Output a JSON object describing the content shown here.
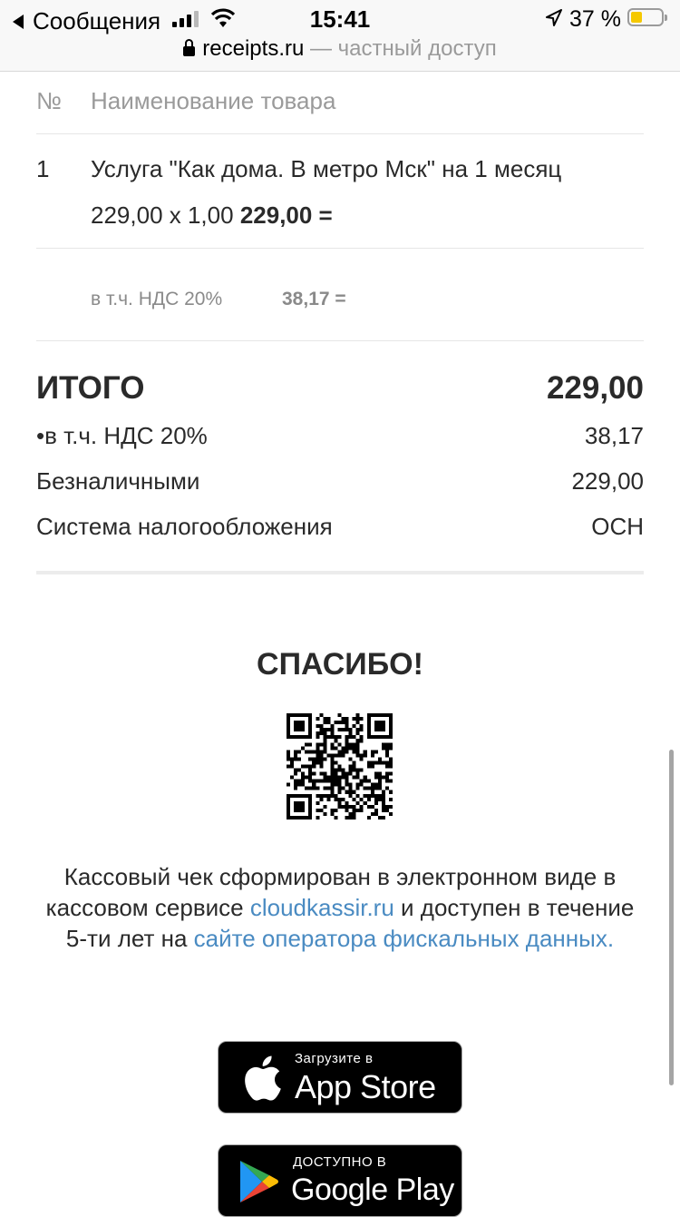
{
  "status_bar": {
    "back_label": "Сообщения",
    "time": "15:41",
    "battery_percent": "37 %",
    "battery_level": 0.37
  },
  "url_bar": {
    "domain": "receipts.ru",
    "suffix": "— частный доступ"
  },
  "table": {
    "header_num": "№",
    "header_name": "Наименование товара",
    "item": {
      "num": "1",
      "name": "Услуга \"Как дома. В метро Мск\" на 1 месяц",
      "calc": "229,00 x 1,00",
      "sum": "229,00 ="
    },
    "vat_label": "в т.ч. НДС 20%",
    "vat_value": "38,17 ="
  },
  "totals": {
    "total_label": "ИТОГО",
    "total_value": "229,00",
    "rows": [
      {
        "label": "•в т.ч. НДС 20%",
        "value": "38,17"
      },
      {
        "label": "Безналичными",
        "value": "229,00"
      },
      {
        "label": "Система налогообложения",
        "value": "ОСН"
      }
    ]
  },
  "footer": {
    "thanks": "СПАСИБО!",
    "note_part1": "Кассовый чек сформирован в электронном виде в кассовом сервисе ",
    "note_link1": "cloudkassir.ru",
    "note_part2": " и доступен в течение 5-ти лет на ",
    "note_link2": "сайте оператора фискальных данных."
  },
  "badges": {
    "appstore_small": "Загрузите в",
    "appstore_big": "App Store",
    "googleplay_small": "ДОСТУПНО В",
    "googleplay_big": "Google Play"
  }
}
